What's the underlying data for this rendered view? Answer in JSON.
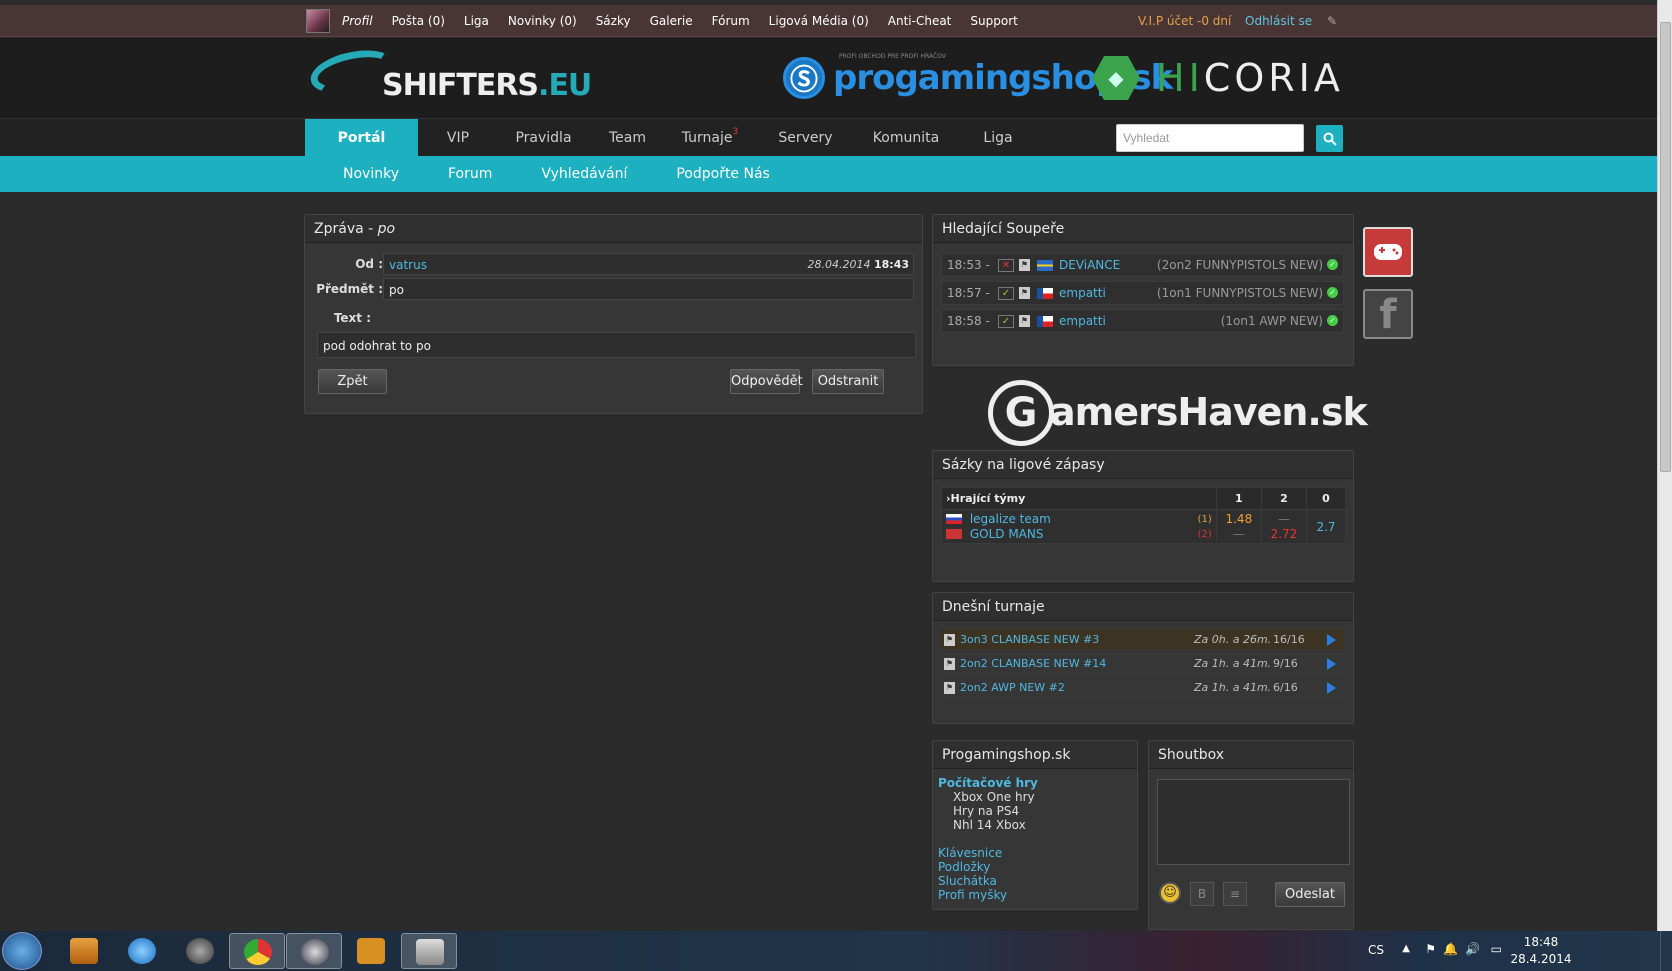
{
  "topbar": {
    "links": [
      "Profil",
      "Pošta (0)",
      "Liga",
      "Novinky (0)",
      "Sázky",
      "Galerie",
      "Fórum",
      "Ligová Média (0)",
      "Anti-Cheat",
      "Support"
    ],
    "vip": "V.I.P účet -0 dní",
    "logout": "Odhlásit se"
  },
  "header": {
    "logo_main": "SHIFTERS",
    "logo_tld": ".EU",
    "sponsor1_tag": "PROFI OBCHOD PRE PROFI HRÁČOV",
    "sponsor1": "progamingshop.sk",
    "sponsor2_a": "HI",
    "sponsor2_b": "CORIA"
  },
  "mainnav": {
    "items": [
      "Portál",
      "VIP",
      "Pravidla",
      "Team",
      "Turnaje",
      "Servery",
      "Komunita",
      "Liga"
    ],
    "turnaje_badge": "3",
    "search_placeholder": "Vyhledat"
  },
  "subnav": {
    "items": [
      "Novinky",
      "Forum",
      "Vyhledávání",
      "Podpořte Nás"
    ]
  },
  "message": {
    "title_prefix": "Zpráva - ",
    "title_subject": "po",
    "from_label": "Od :",
    "from": "vatrus",
    "date": "28.04.2014",
    "time": "18:43",
    "subject_label": "Předmět :",
    "subject": "po",
    "text_label": "Text :",
    "text": "pod odohrat to po",
    "btn_back": "Zpět",
    "btn_reply": "Odpovědět",
    "btn_delete": "Odstranit"
  },
  "opponents": {
    "title": "Hledající Soupeře",
    "rows": [
      {
        "time": "18:53 -",
        "status": "x",
        "team": "DEViANCE",
        "mode": "(2on2 FUNNYPISTOLS NEW)"
      },
      {
        "time": "18:57 -",
        "status": "ok",
        "team": "empatti",
        "mode": "(1on1 FUNNYPISTOLS NEW)"
      },
      {
        "time": "18:58 -",
        "status": "ok",
        "team": "empatti",
        "mode": "(1on1 AWP NEW)"
      }
    ]
  },
  "banner": {
    "text": "amersHaven.sk",
    "g": "G"
  },
  "bets": {
    "title": "Sázky na ligové zápasy",
    "col_teams": "›Hrající týmy",
    "col_1": "1",
    "col_2": "2",
    "col_0": "0",
    "team1": "legalize team",
    "team1_tag": "(1)",
    "team2": "GOLD MANS",
    "team2_tag": "(2)",
    "odd1": "1.48",
    "odd2": "2.72",
    "odd0": "2.7",
    "dash": "—"
  },
  "tournaments": {
    "title": "Dnešní turnaje",
    "rows": [
      {
        "name": "3on3 CLANBASE NEW #3",
        "time": "Za 0h. a 26m.",
        "count": "16/16"
      },
      {
        "name": "2on2 CLANBASE NEW #14",
        "time": "Za 1h. a 41m.",
        "count": "9/16"
      },
      {
        "name": "2on2 AWP NEW #2",
        "time": "Za 1h. a 41m.",
        "count": "6/16"
      }
    ]
  },
  "shop": {
    "title": "Progamingshop.sk",
    "cat": "Počítačové hry",
    "sub": [
      "Xbox One hry",
      "Hry na PS4",
      "Nhl 14 Xbox"
    ],
    "links": [
      "Klávesnice",
      "Podložky",
      "Sluchátka",
      "Profi myšky"
    ]
  },
  "shoutbox": {
    "title": "Shoutbox",
    "send": "Odeslat"
  },
  "tray": {
    "lang": "CS",
    "time": "18:48",
    "date": "28.4.2014"
  },
  "colors": {
    "accent": "#1cb0c0",
    "link": "#4fb8e0",
    "topbar": "#4a3535"
  }
}
